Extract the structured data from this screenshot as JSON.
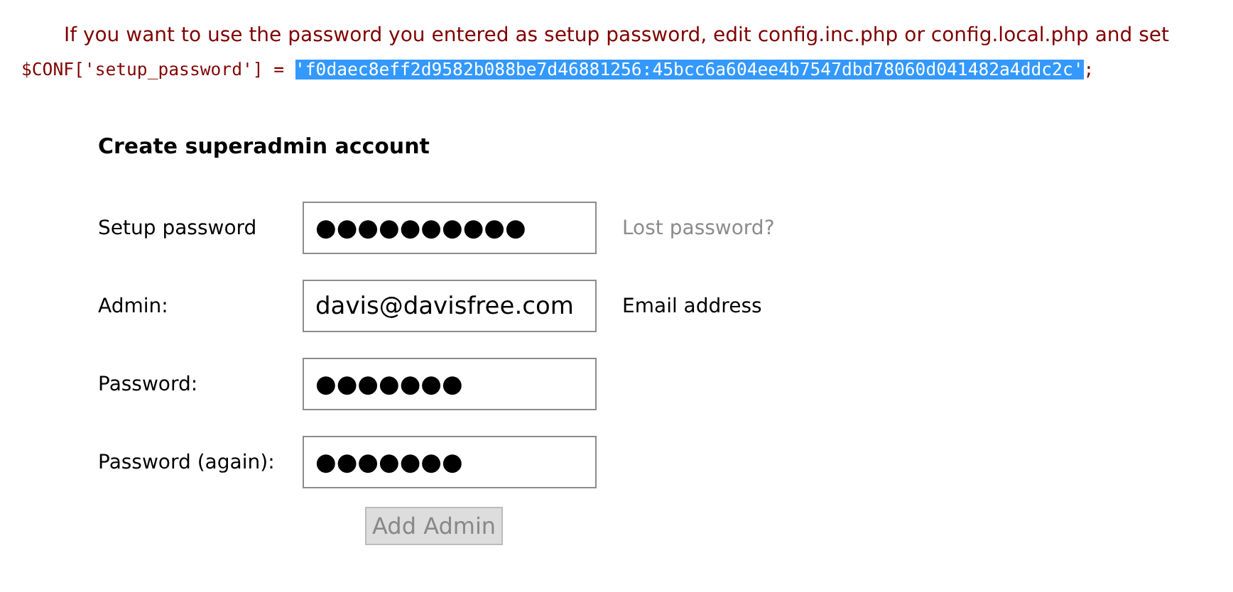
{
  "notice": {
    "message": "If you want to use the password you entered as setup password, edit config.inc.php or config.local.php and set",
    "code_prefix": "$CONF['setup_password'] = ",
    "code_hash": "'f0daec8eff2d9582b088be7d46881256:45bcc6a604ee4b7547dbd78060d041482a4ddc2c'",
    "hash_selected": true,
    "code_suffix": ";"
  },
  "form": {
    "title": "Create superadmin account",
    "fields": [
      {
        "label": "Setup password",
        "value": "●●●●●●●●●●",
        "hint": {
          "kind": "link",
          "text": "Lost password?"
        }
      },
      {
        "label": "Admin:",
        "value": "davis@davisfree.com",
        "hint": {
          "kind": "note",
          "text": "Email address"
        }
      },
      {
        "label": "Password:",
        "value": "●●●●●●●"
      },
      {
        "label": "Password (again):",
        "value": "●●●●●●●"
      }
    ],
    "submit": {
      "label": "Add Admin",
      "disabled": true
    }
  }
}
